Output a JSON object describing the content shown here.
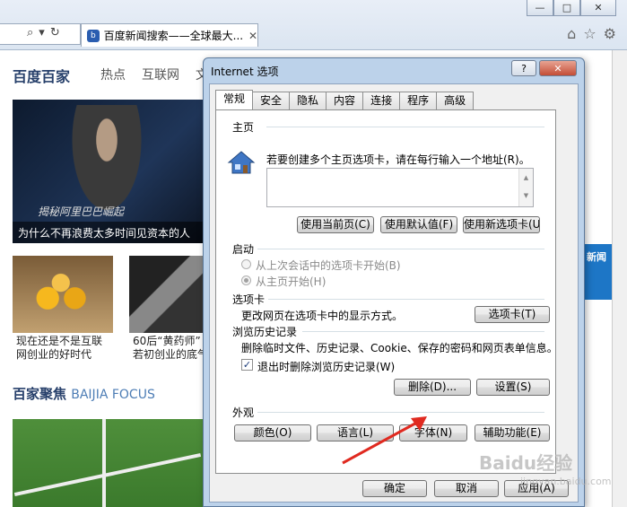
{
  "browser": {
    "tab_title": "百度新闻搜索——全球最大...",
    "tab_close": "✕",
    "window_buttons": [
      "—",
      "□",
      "✕"
    ]
  },
  "page": {
    "logo": "百度百家",
    "nav": [
      "热点",
      "互联网",
      "文"
    ],
    "hero_caption": "为什么不再浪费太多时间见资本的人",
    "hero_signature": "揭秘阿里巴巴崛起",
    "thumb1_caption": [
      "现在还是不是互联",
      "网创业的好时代"
    ],
    "thumb2_caption": [
      "60后“黄药师”",
      "若初创业的底气"
    ],
    "section_title": "百家聚焦",
    "section_en": "BAIJIA FOCUS",
    "ad_text": "新闻"
  },
  "dialog": {
    "title": "Internet 选项",
    "help": "?",
    "close": "✕",
    "tabs": [
      "常规",
      "安全",
      "隐私",
      "内容",
      "连接",
      "程序",
      "高级"
    ],
    "home": {
      "group": "主页",
      "desc": "若要创建多个主页选项卡，请在每行输入一个地址(R)。",
      "btn_current": "使用当前页(C)",
      "btn_default": "使用默认值(F)",
      "btn_newtab": "使用新选项卡(U)"
    },
    "startup": {
      "group": "启动",
      "opt1": "从上次会话中的选项卡开始(B)",
      "opt2": "从主页开始(H)"
    },
    "tabs_group": {
      "group": "选项卡",
      "desc": "更改网页在选项卡中的显示方式。",
      "btn": "选项卡(T)"
    },
    "history": {
      "group": "浏览历史记录",
      "desc": "删除临时文件、历史记录、Cookie、保存的密码和网页表单信息。",
      "checkbox": "退出时删除浏览历史记录(W)",
      "checked": true,
      "btn_delete": "删除(D)...",
      "btn_settings": "设置(S)"
    },
    "appearance": {
      "group": "外观",
      "btn_colors": "颜色(O)",
      "btn_languages": "语言(L)",
      "btn_fonts": "字体(N)",
      "btn_accessibility": "辅助功能(E)"
    },
    "footer": {
      "ok": "确定",
      "cancel": "取消",
      "apply": "应用(A)"
    }
  },
  "watermark": {
    "main": "Baidu经验",
    "sub": "jingyan.baidu.com"
  },
  "colors": {
    "dialog_frame": "#bcd2ea",
    "logo": "#27406b",
    "arrow": "#e02a20"
  }
}
